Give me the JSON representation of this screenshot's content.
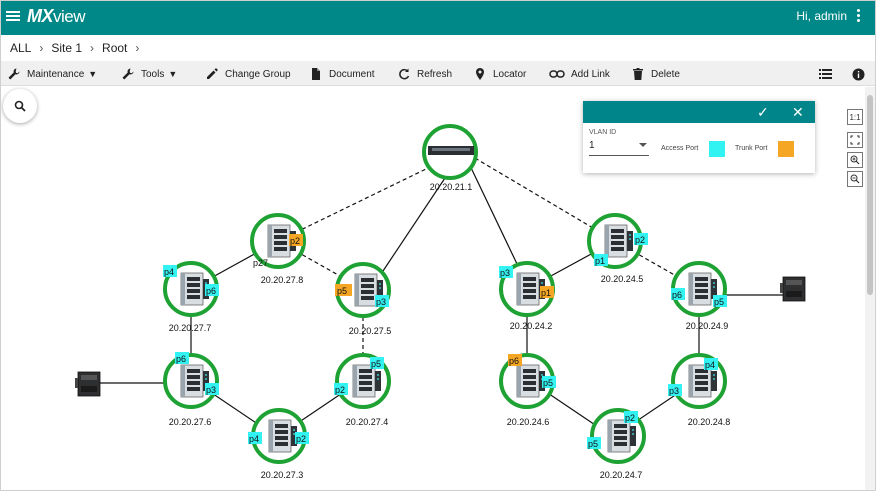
{
  "app": {
    "logo_main": "MX",
    "logo_sub": "view",
    "greeting": "Hi, admin"
  },
  "breadcrumb": [
    "ALL",
    "Site 1",
    "Root"
  ],
  "toolbar": {
    "maintenance": "Maintenance",
    "tools": "Tools",
    "change_group": "Change Group",
    "document": "Document",
    "refresh": "Refresh",
    "locator": "Locator",
    "add_link": "Add Link",
    "delete": "Delete"
  },
  "vlan_panel": {
    "label": "VLAN ID",
    "value": "1",
    "access_label": "Access Port",
    "trunk_label": "Trunk Port",
    "access_color": "#33f2f2",
    "trunk_color": "#f5a623"
  },
  "zoom_controls": {
    "fit": "1:1"
  },
  "colors": {
    "topbar": "#008787",
    "ring": "#1fa234",
    "access": "#33f2f2",
    "trunk": "#f5a623"
  },
  "devices": [
    {
      "id": "root",
      "ip": "20.20.21.1",
      "kind": "core"
    },
    {
      "id": "d278",
      "ip": "20.20.27.8",
      "kind": "switch"
    },
    {
      "id": "d277",
      "ip": "20.20.27.7",
      "kind": "switch"
    },
    {
      "id": "d275",
      "ip": "20.20.27.5",
      "kind": "switch"
    },
    {
      "id": "d276",
      "ip": "20.20.27.6",
      "kind": "switch"
    },
    {
      "id": "d274",
      "ip": "20.20.27.4",
      "kind": "switch"
    },
    {
      "id": "d273",
      "ip": "20.20.27.3",
      "kind": "switch"
    },
    {
      "id": "d245",
      "ip": "20.20.24.5",
      "kind": "switch"
    },
    {
      "id": "d242",
      "ip": "20.20.24.2",
      "kind": "switch"
    },
    {
      "id": "d249",
      "ip": "20.20.24.9",
      "kind": "switch"
    },
    {
      "id": "d246",
      "ip": "20.20.24.6",
      "kind": "switch"
    },
    {
      "id": "d248",
      "ip": "20.20.24.8",
      "kind": "switch"
    },
    {
      "id": "d247",
      "ip": "20.20.24.7",
      "kind": "switch"
    }
  ],
  "ports": [
    {
      "label": "p2",
      "type": "trunk"
    },
    {
      "label": "p27",
      "type": "none"
    },
    {
      "label": "p4",
      "type": "access"
    },
    {
      "label": "p6",
      "type": "access"
    },
    {
      "label": "p5",
      "type": "trunk"
    },
    {
      "label": "p3",
      "type": "access"
    },
    {
      "label": "p6",
      "type": "access"
    },
    {
      "label": "p3",
      "type": "access"
    },
    {
      "label": "p5",
      "type": "access"
    },
    {
      "label": "p2",
      "type": "access"
    },
    {
      "label": "p4",
      "type": "access"
    },
    {
      "label": "p2",
      "type": "access"
    },
    {
      "label": "p2",
      "type": "access"
    },
    {
      "label": "p1",
      "type": "access"
    },
    {
      "label": "p3",
      "type": "access"
    },
    {
      "label": "p1",
      "type": "trunk"
    },
    {
      "label": "p6",
      "type": "access"
    },
    {
      "label": "p5",
      "type": "access"
    },
    {
      "label": "p6",
      "type": "trunk"
    },
    {
      "label": "p5",
      "type": "access"
    },
    {
      "label": "p4",
      "type": "access"
    },
    {
      "label": "p3",
      "type": "access"
    },
    {
      "label": "p2",
      "type": "access"
    },
    {
      "label": "p5",
      "type": "access"
    }
  ]
}
